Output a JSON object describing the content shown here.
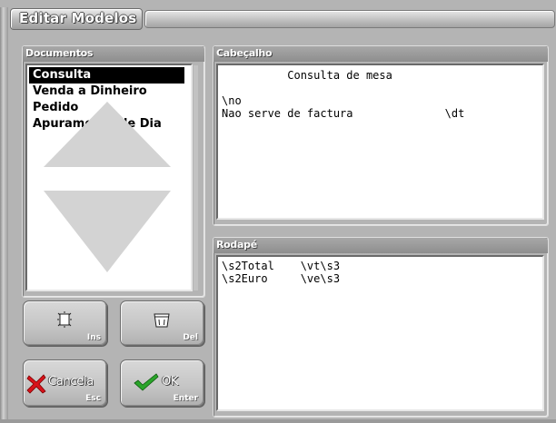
{
  "window": {
    "title": "Editar Modelos"
  },
  "documents": {
    "label": "Documentos",
    "items": [
      "Consulta",
      "Venda a Dinheiro",
      "Pedido",
      "Apuramento de Dia"
    ],
    "selected_index": 0
  },
  "header": {
    "label": "Cabeçalho",
    "lines": [
      "          Consulta de mesa",
      "",
      "\\no",
      "Nao serve de factura              \\dt"
    ]
  },
  "footer": {
    "label": "Rodapé",
    "lines": [
      "\\s2Total    \\vt\\s3",
      "\\s2Euro     \\ve\\s3"
    ]
  },
  "buttons": {
    "insert": {
      "key": "Ins",
      "icon": "insert-document-icon"
    },
    "delete": {
      "key": "Del",
      "icon": "trash-icon"
    },
    "cancel": {
      "label": "Cancela",
      "key": "Esc",
      "icon": "red-x-icon"
    },
    "ok": {
      "label": "OK",
      "key": "Enter",
      "icon": "green-check-icon"
    }
  },
  "colors": {
    "panel": "#b4b4b4",
    "selection": "#000000",
    "cancel_icon": "#d8121a",
    "ok_icon": "#2aa52a"
  }
}
